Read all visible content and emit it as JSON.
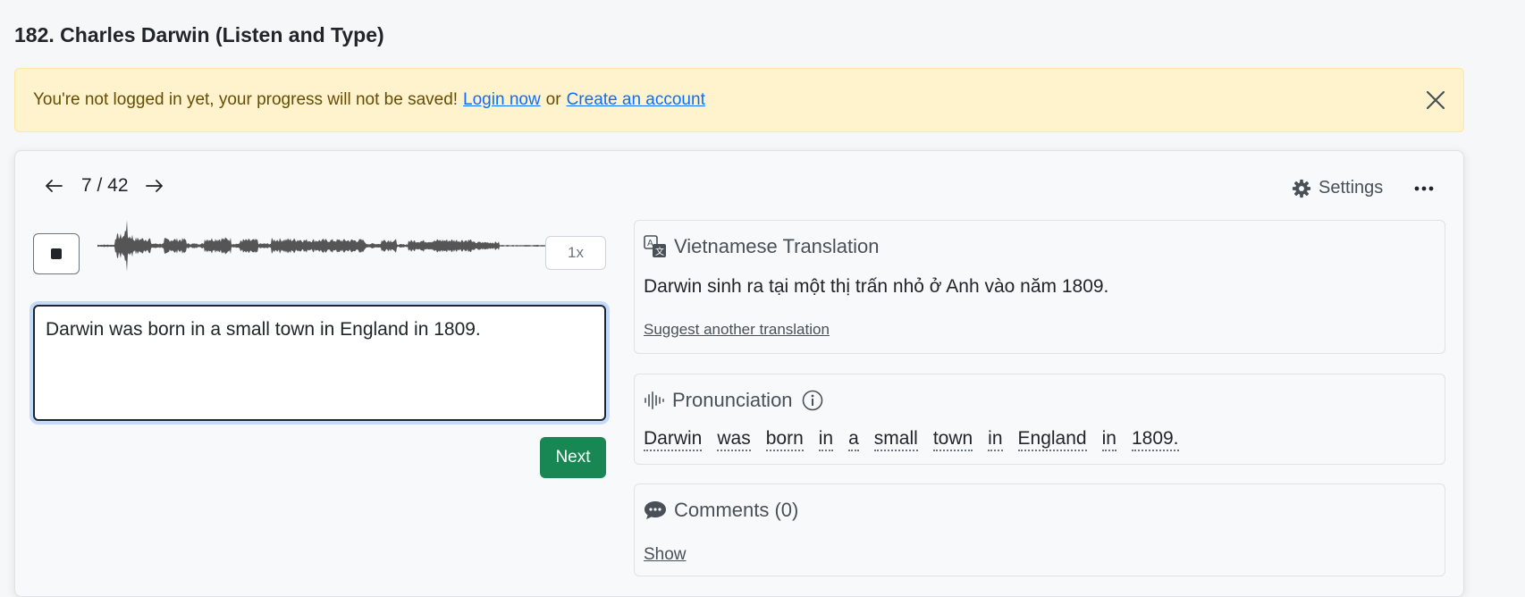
{
  "page": {
    "title": "182. Charles Darwin (Listen and Type)"
  },
  "alert": {
    "message": "You're not logged in yet, your progress will not be saved!",
    "login_link": "Login now",
    "or_text": "or",
    "create_link": "Create an account"
  },
  "nav": {
    "counter": "7 / 42"
  },
  "toolbar": {
    "settings_label": "Settings"
  },
  "player": {
    "speed": "1x",
    "icons": [
      "stop-icon",
      "waveform"
    ]
  },
  "answer": {
    "value": "Darwin was born in a small town in England in 1809.",
    "next_label": "Next"
  },
  "translation": {
    "title": "Vietnamese Translation",
    "text": "Darwin sinh ra tại một thị trấn nhỏ ở Anh vào năm 1809.",
    "suggest_link": "Suggest another translation"
  },
  "pronunciation": {
    "title": "Pronunciation",
    "words": [
      "Darwin",
      "was",
      "born",
      "in",
      "a",
      "small",
      "town",
      "in",
      "England",
      "in",
      "1809."
    ]
  },
  "comments": {
    "title": "Comments (0)",
    "show_link": "Show"
  },
  "colors": {
    "alert_bg": "#fff3cd",
    "alert_text": "#664d03",
    "link": "#0d6efd",
    "next_button": "#198754"
  }
}
